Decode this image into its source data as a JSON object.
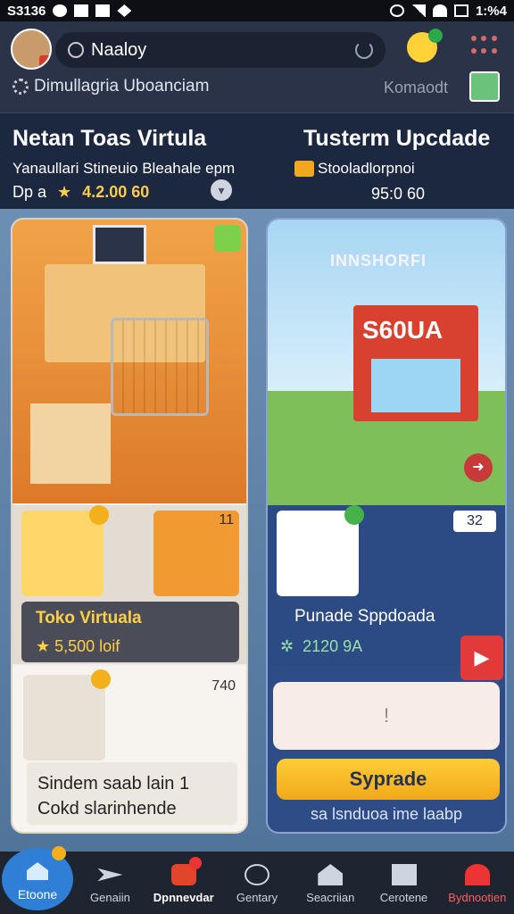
{
  "status_bar": {
    "time_left": "S3136",
    "time_right": "1:%4"
  },
  "topbar": {
    "search_text": "Naaloy",
    "subtitle": "Dimullagria Uboanciam",
    "right_label": "Komaodt"
  },
  "header": {
    "left_title": "Netan Toas Virtula",
    "right_title": "Tusterm Upcdade",
    "left_sub": "Yanaullari Stineuio Bleahale epm",
    "right_sub": "Stooladlorpnoi",
    "left_val_prefix": "Dp a",
    "left_val": "4.2.00 60",
    "right_val": "95:0 60"
  },
  "left_card": {
    "tile2_num": "11",
    "title": "Toko Virtuala",
    "price": "5,500 loif",
    "bottom_num": "740",
    "bottom_text": [
      "Sindem saab lain 1",
      "Cokd slarinhende"
    ]
  },
  "right_card": {
    "sky_text": "INNSHORFI",
    "store_sign": "S60UA",
    "num": "32",
    "name": "Punade Sppdoada",
    "price": "2120 9A",
    "blank": "!",
    "upgrade_label": "Syprade",
    "footer": "sa lsnduoa ime laabp"
  },
  "nav": [
    {
      "label": "Etoone"
    },
    {
      "label": "Genaiin"
    },
    {
      "label": "Dpnnevdar"
    },
    {
      "label": "Gentary"
    },
    {
      "label": "Seacriian"
    },
    {
      "label": "Cerotene"
    },
    {
      "label": "Bydnootien"
    }
  ],
  "colors": {
    "accent": "#ffcc38",
    "nav_active": "#2f7fd6",
    "danger": "#e23a3a"
  }
}
